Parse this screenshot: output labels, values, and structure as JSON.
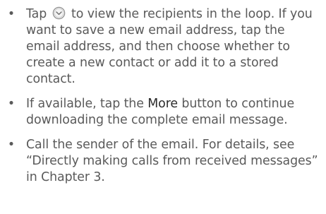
{
  "bullets": [
    {
      "symbol": "•",
      "text_before_icon": "Tap",
      "icon": "expand-chevron-down-circle-icon",
      "text_after_icon": "to view the recipients in the loop. If you want to save a new email address, tap the email address, and then choose whether to create a new contact or add it to a stored contact."
    },
    {
      "symbol": "•",
      "text_before_strong": "If available, tap the",
      "strong": "More",
      "text_after_strong": "button to continue downloading the complete email message."
    },
    {
      "symbol": "•",
      "text": "Call the sender of the email. For details, see “Directly making calls from received messages” in Chapter 3."
    }
  ],
  "colors": {
    "text": "#5a5a5a",
    "emphasis": "#2b2b2b",
    "icon_ring": "#8f8f8f"
  }
}
